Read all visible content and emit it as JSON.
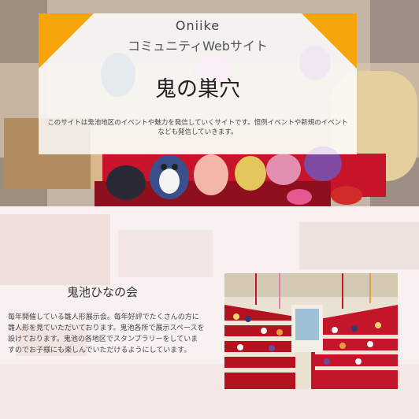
{
  "hero": {
    "brand": "Oniike",
    "tagline": "コミュニティWebサイト",
    "title": "鬼の巣穴",
    "intro": "このサイトは鬼池地区のイベントや魅力を発信していくサイトです。恒例イベントや新規のイベントなども発信していきます。"
  },
  "event": {
    "title": "鬼池ひなの会",
    "description": "毎年開催している雛人形展示会。毎年好評でたくさんの方に雛人形を見ていただいております。鬼池各所で展示スペースを設けております。鬼池の各地区でスタンプラリーをしていますのでお子様にも楽しんでいただけるようにしています。"
  },
  "colors": {
    "accent": "#f5a40a",
    "card": "#ffffff",
    "hina_red": "#c8142a"
  }
}
